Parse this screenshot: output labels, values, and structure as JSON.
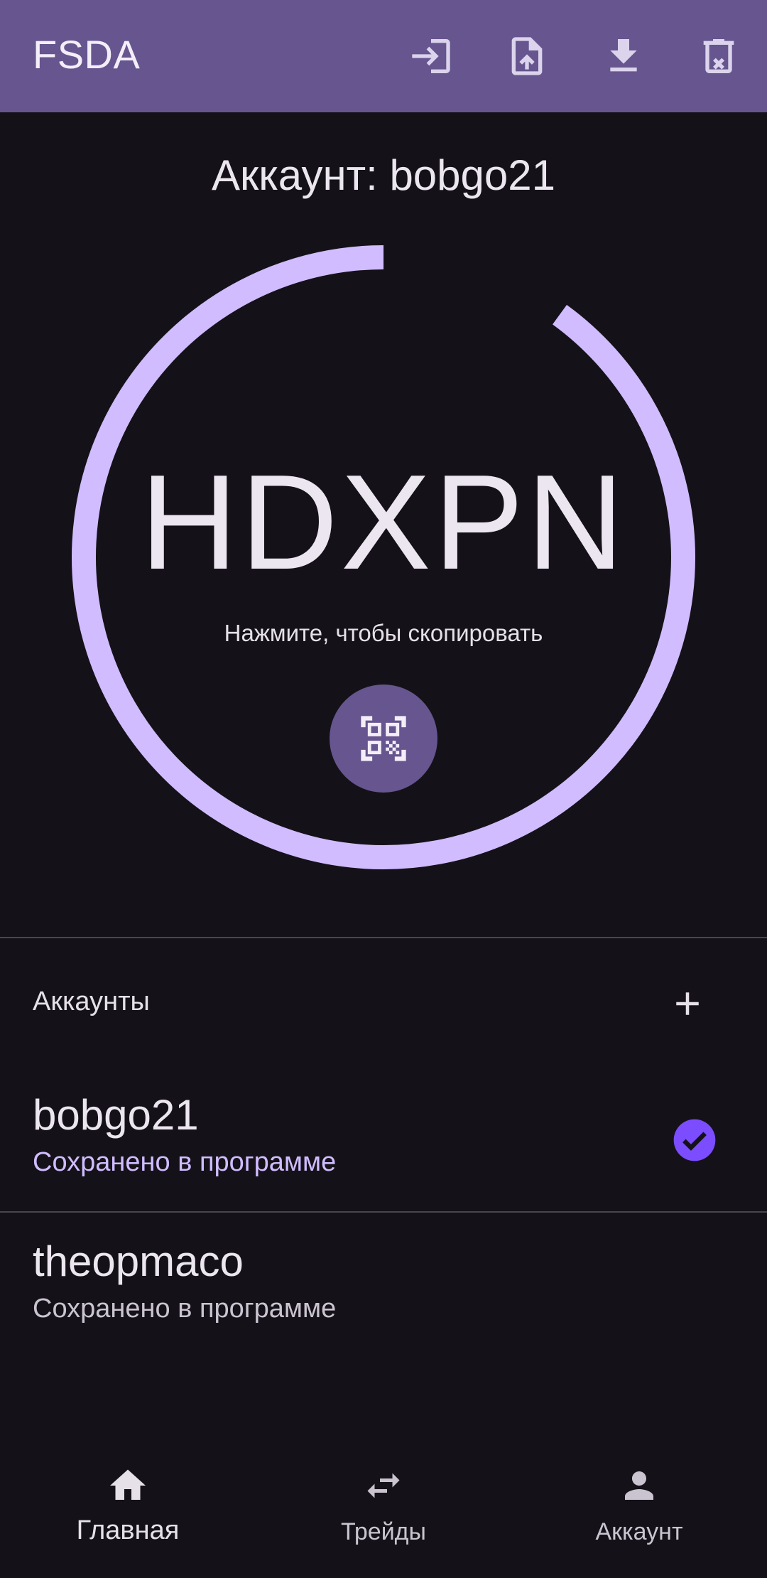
{
  "app_bar": {
    "title": "FSDA",
    "icons": [
      "login-icon",
      "file-upload-icon",
      "download-icon",
      "delete-icon"
    ]
  },
  "current_account": {
    "header": "Аккаунт: bobgo21",
    "code": "HDXPN",
    "copy_hint": "Нажмите, чтобы скопировать",
    "progress": 0.9
  },
  "accounts": {
    "label": "Аккаунты",
    "items": [
      {
        "name": "bobgo21",
        "status": "Сохранено в программе",
        "selected": true
      },
      {
        "name": "theopmaco",
        "status": "Сохранено в программе",
        "selected": false
      }
    ]
  },
  "bottom_nav": {
    "items": [
      {
        "label": "Главная",
        "icon": "home-icon",
        "active": true
      },
      {
        "label": "Трейды",
        "icon": "swap-icon",
        "active": false
      },
      {
        "label": "Аккаунт",
        "icon": "person-icon",
        "active": false
      }
    ]
  },
  "colors": {
    "app_bar": "#66558f",
    "background": "#141218",
    "accent": "#d0bcff",
    "check": "#7c4dff"
  }
}
